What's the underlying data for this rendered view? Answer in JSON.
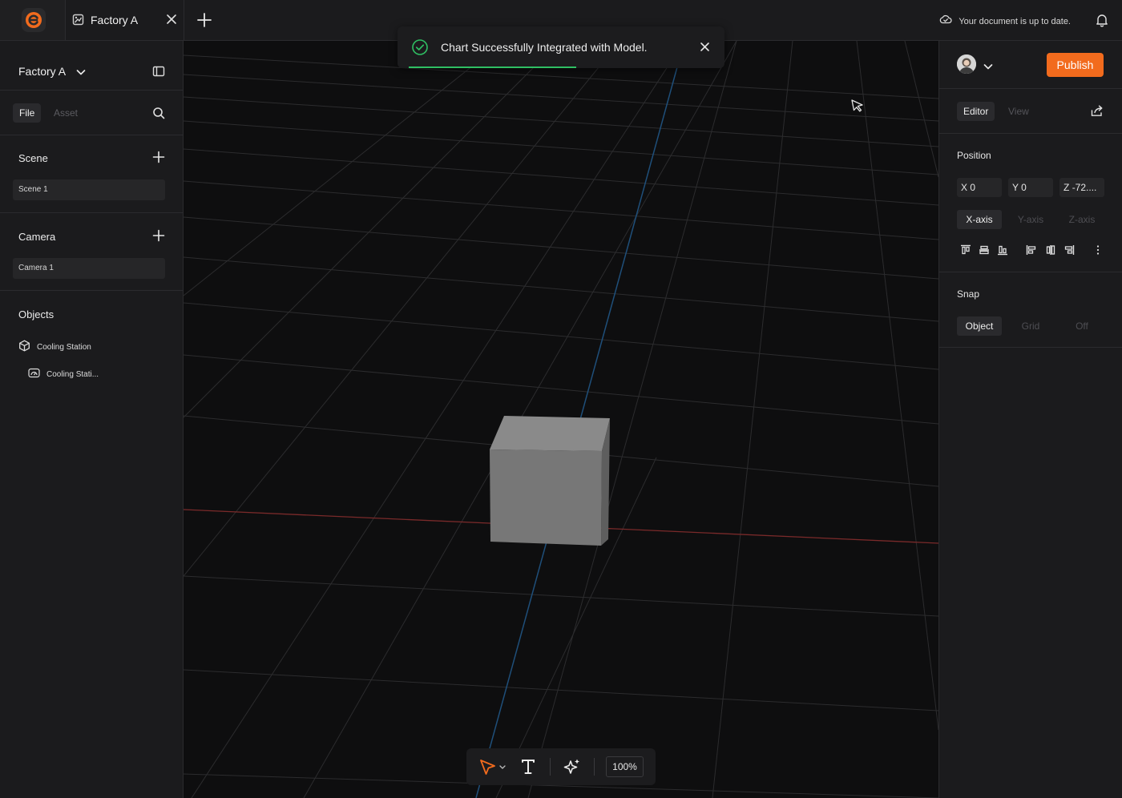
{
  "topbar": {
    "tab_title": "Factory A",
    "sync_status": "Your document is up to date.",
    "brand_color": "#f26b1d"
  },
  "left_panel": {
    "project_name": "Factory A",
    "segments": [
      "File",
      "Asset"
    ],
    "scene": {
      "title": "Scene",
      "items": [
        "Scene 1"
      ]
    },
    "camera": {
      "title": "Camera",
      "items": [
        "Camera 1"
      ]
    },
    "objects": {
      "title": "Objects",
      "items": [
        {
          "label": "Cooling Station",
          "icon": "cube-icon"
        },
        {
          "label": "Cooling Stati...",
          "icon": "dashboard-gauge-icon"
        }
      ]
    }
  },
  "toast": {
    "message": "Chart Successfully Integrated with Model.",
    "progress": 0.55,
    "success_color": "#2fbf63"
  },
  "bottom_toolbar": {
    "zoom": "100%",
    "tools": [
      "select-pointer-icon",
      "text-tool-icon",
      "ai-sparkle-icon"
    ]
  },
  "right_panel": {
    "publish_label": "Publish",
    "tabs": [
      "Editor",
      "View"
    ],
    "position": {
      "title": "Position",
      "fields": [
        {
          "axis": "X",
          "value": "0"
        },
        {
          "axis": "Y",
          "value": "0"
        },
        {
          "axis": "Z",
          "value": "-72...."
        }
      ],
      "axes": [
        "X-axis",
        "Y-axis",
        "Z-axis"
      ]
    },
    "snap": {
      "title": "Snap",
      "options": [
        "Object",
        "Grid",
        "Off"
      ]
    }
  }
}
